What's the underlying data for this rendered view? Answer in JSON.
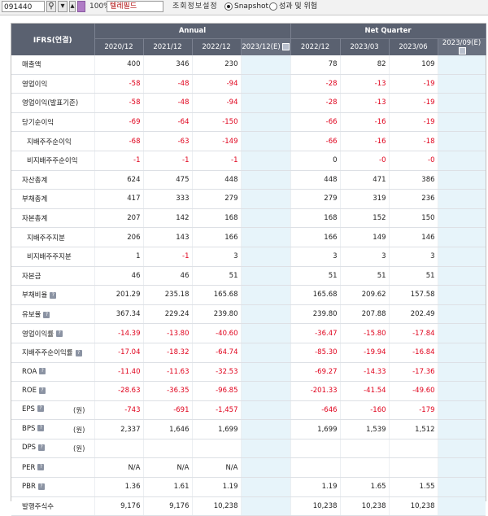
{
  "toolbar": {
    "stock_code": "091440",
    "search_icon": "search-icon",
    "rate": "100%",
    "company_name": "텔레필드",
    "setting_label": "조회정보설정",
    "radio_snapshot": "Snapshot",
    "radio_perf": "성과 및 위험"
  },
  "table": {
    "corner_label": "IFRS(연결)",
    "group_annual": "Annual",
    "group_quarter": "Net Quarter",
    "annual_periods": [
      "2020/12",
      "2021/12",
      "2022/12",
      "2023/12(E)"
    ],
    "quarter_periods": [
      "2022/12",
      "2023/03",
      "2023/06",
      "2023/09(E)"
    ],
    "rows": [
      {
        "label": "매출액",
        "annual": [
          "400",
          "346",
          "230",
          ""
        ],
        "quarter": [
          "78",
          "82",
          "109",
          ""
        ]
      },
      {
        "label": "영업이익",
        "annual": [
          "-58",
          "-48",
          "-94",
          ""
        ],
        "quarter": [
          "-28",
          "-13",
          "-19",
          ""
        ]
      },
      {
        "label": "영업이익(발표기준)",
        "annual": [
          "-58",
          "-48",
          "-94",
          ""
        ],
        "quarter": [
          "-28",
          "-13",
          "-19",
          ""
        ]
      },
      {
        "label": "당기순이익",
        "annual": [
          "-69",
          "-64",
          "-150",
          ""
        ],
        "quarter": [
          "-66",
          "-16",
          "-19",
          ""
        ]
      },
      {
        "label": "지배주주순이익",
        "annual": [
          "-68",
          "-63",
          "-149",
          ""
        ],
        "quarter": [
          "-66",
          "-16",
          "-18",
          ""
        ]
      },
      {
        "label": "비지배주주순이익",
        "annual": [
          "-1",
          "-1",
          "-1",
          ""
        ],
        "quarter": [
          "0",
          "-0",
          "-0",
          ""
        ]
      },
      {
        "label": "자산총계",
        "annual": [
          "624",
          "475",
          "448",
          ""
        ],
        "quarter": [
          "448",
          "471",
          "386",
          ""
        ]
      },
      {
        "label": "부채총계",
        "annual": [
          "417",
          "333",
          "279",
          ""
        ],
        "quarter": [
          "279",
          "319",
          "236",
          ""
        ]
      },
      {
        "label": "자본총계",
        "annual": [
          "207",
          "142",
          "168",
          ""
        ],
        "quarter": [
          "168",
          "152",
          "150",
          ""
        ]
      },
      {
        "label": "지배주주지분",
        "annual": [
          "206",
          "143",
          "166",
          ""
        ],
        "quarter": [
          "166",
          "149",
          "146",
          ""
        ]
      },
      {
        "label": "비지배주주지분",
        "annual": [
          "1",
          "-1",
          "3",
          ""
        ],
        "quarter": [
          "3",
          "3",
          "3",
          ""
        ]
      },
      {
        "label": "자본금",
        "annual": [
          "46",
          "46",
          "51",
          ""
        ],
        "quarter": [
          "51",
          "51",
          "51",
          ""
        ]
      },
      {
        "label": "부채비율",
        "annual": [
          "201.29",
          "235.18",
          "165.68",
          ""
        ],
        "quarter": [
          "165.68",
          "209.62",
          "157.58",
          ""
        ]
      },
      {
        "label": "유보율",
        "annual": [
          "367.34",
          "229.24",
          "239.80",
          ""
        ],
        "quarter": [
          "239.80",
          "207.88",
          "202.49",
          ""
        ]
      },
      {
        "label": "영업이익률",
        "annual": [
          "-14.39",
          "-13.80",
          "-40.60",
          ""
        ],
        "quarter": [
          "-36.47",
          "-15.80",
          "-17.84",
          ""
        ]
      },
      {
        "label": "지배주주순이익률",
        "annual": [
          "-17.04",
          "-18.32",
          "-64.74",
          ""
        ],
        "quarter": [
          "-85.30",
          "-19.94",
          "-16.84",
          ""
        ]
      },
      {
        "label": "ROA",
        "annual": [
          "-11.40",
          "-11.63",
          "-32.53",
          ""
        ],
        "quarter": [
          "-69.27",
          "-14.33",
          "-17.36",
          ""
        ]
      },
      {
        "label": "ROE",
        "annual": [
          "-28.63",
          "-36.35",
          "-96.85",
          ""
        ],
        "quarter": [
          "-201.33",
          "-41.54",
          "-49.60",
          ""
        ]
      },
      {
        "label": "EPS",
        "unit": "(원)",
        "annual": [
          "-743",
          "-691",
          "-1,457",
          ""
        ],
        "quarter": [
          "-646",
          "-160",
          "-179",
          ""
        ]
      },
      {
        "label": "BPS",
        "unit": "(원)",
        "annual": [
          "2,337",
          "1,646",
          "1,699",
          ""
        ],
        "quarter": [
          "1,699",
          "1,539",
          "1,512",
          ""
        ]
      },
      {
        "label": "DPS",
        "unit": "(원)",
        "annual": [
          "",
          "",
          "",
          ""
        ],
        "quarter": [
          "",
          "",
          "",
          ""
        ]
      },
      {
        "label": "PER",
        "annual": [
          "N/A",
          "N/A",
          "N/A",
          ""
        ],
        "quarter": [
          "",
          "",
          "",
          ""
        ]
      },
      {
        "label": "PBR",
        "annual": [
          "1.36",
          "1.61",
          "1.19",
          ""
        ],
        "quarter": [
          "1.19",
          "1.65",
          "1.55",
          ""
        ]
      },
      {
        "label": "발행주식수",
        "annual": [
          "9,176",
          "9,176",
          "10,238",
          ""
        ],
        "quarter": [
          "10,238",
          "10,238",
          "10,238",
          ""
        ]
      }
    ]
  },
  "colors": {
    "header_bg": "#5a6170",
    "estimate_bg": "#e7f4fa",
    "negative": "#e0001b"
  }
}
